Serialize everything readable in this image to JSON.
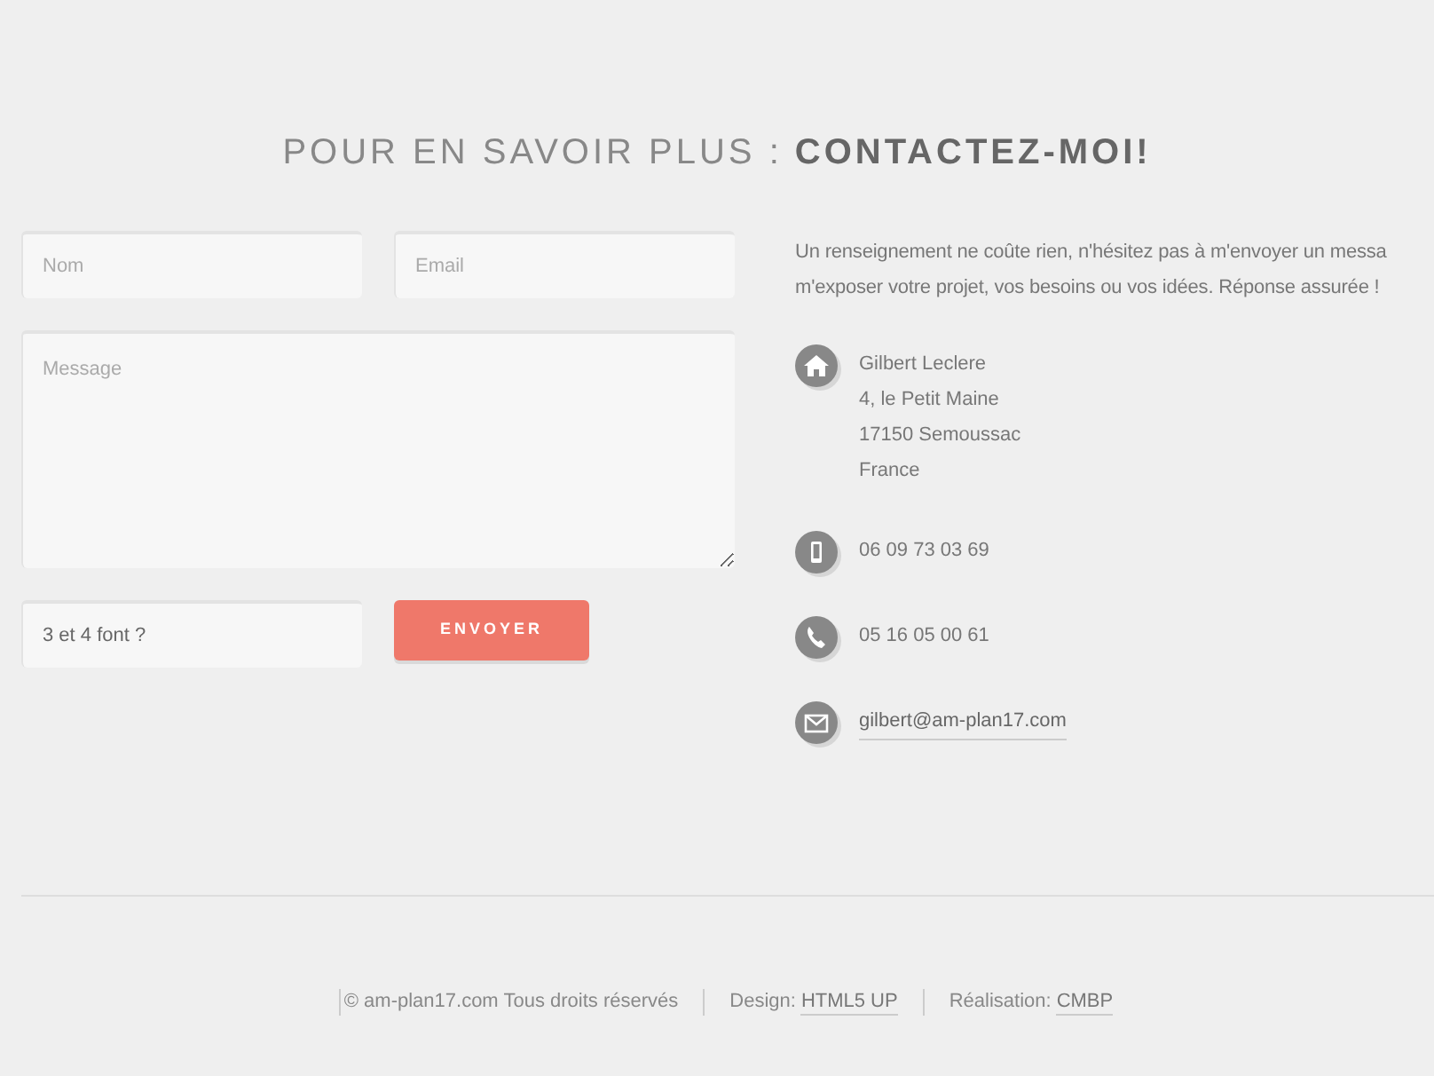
{
  "heading": {
    "lead": "POUR EN SAVOIR PLUS :",
    "strong": "CONTACTEZ-MOI!"
  },
  "form": {
    "name": {
      "placeholder": "Nom"
    },
    "email": {
      "placeholder": "Email"
    },
    "message": {
      "placeholder": "Message"
    },
    "captcha": {
      "value": "3 et 4 font ?"
    },
    "submit": "ENVOYER"
  },
  "intro": [
    "Un renseignement ne coûte rien, n'hésitez pas à m'envoyer un messa",
    "m'exposer votre projet, vos besoins ou vos idées. Réponse assurée !"
  ],
  "contacts": [
    {
      "kind": "address",
      "lines": [
        "Gilbert Leclere",
        "4, le Petit Maine",
        "17150 Semoussac",
        "France"
      ]
    },
    {
      "kind": "mobile",
      "lines": [
        "06 09 73 03 69"
      ]
    },
    {
      "kind": "phone",
      "lines": [
        "05 16 05 00 61"
      ]
    },
    {
      "kind": "email",
      "lines": [
        "gilbert@am-plan17.com"
      ]
    }
  ],
  "footer": [
    {
      "text": "© am-plan17.com Tous droits réservés"
    },
    {
      "text": "Design:",
      "link": "HTML5 UP"
    },
    {
      "text": "Réalisation:",
      "link": "CMBP"
    }
  ]
}
